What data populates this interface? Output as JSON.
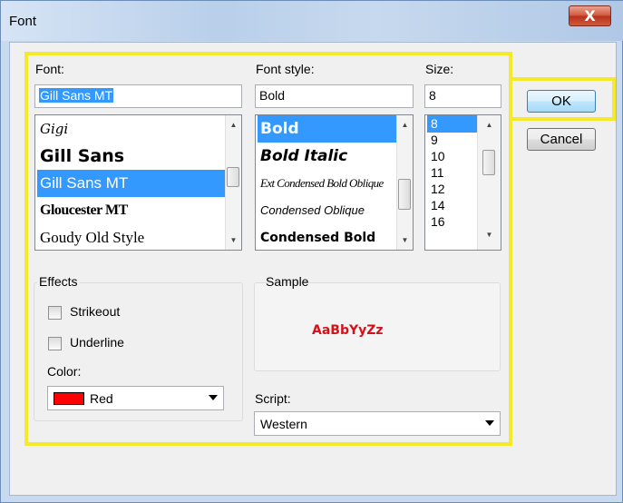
{
  "window": {
    "title": "Font",
    "close_glyph": "X"
  },
  "font": {
    "label": "Font:",
    "value": "Gill Sans MT",
    "items": [
      "Gigi",
      "Gill Sans",
      "Gill Sans MT",
      "Gloucester MT",
      "Goudy Old Style"
    ],
    "selected": "Gill Sans MT"
  },
  "style": {
    "label": "Font style:",
    "value": "Bold",
    "items": [
      "Bold",
      "Bold Italic",
      "Ext Condensed Bold Oblique",
      "Condensed Oblique",
      "Condensed Bold"
    ],
    "selected": "Bold"
  },
  "size": {
    "label": "Size:",
    "value": "8",
    "items": [
      "8",
      "9",
      "10",
      "11",
      "12",
      "14",
      "16"
    ],
    "selected": "8"
  },
  "buttons": {
    "ok": "OK",
    "cancel": "Cancel"
  },
  "effects": {
    "label": "Effects",
    "strikeout": "Strikeout",
    "underline": "Underline",
    "color_label": "Color:",
    "color_value": "Red",
    "color_swatch": "#ff0000"
  },
  "sample": {
    "label": "Sample",
    "text": "AaBbYyZz",
    "color": "#d4121a"
  },
  "script": {
    "label": "Script:",
    "value": "Western"
  },
  "colors": {
    "highlight": "#f6e92a",
    "selection": "#3399ff"
  }
}
